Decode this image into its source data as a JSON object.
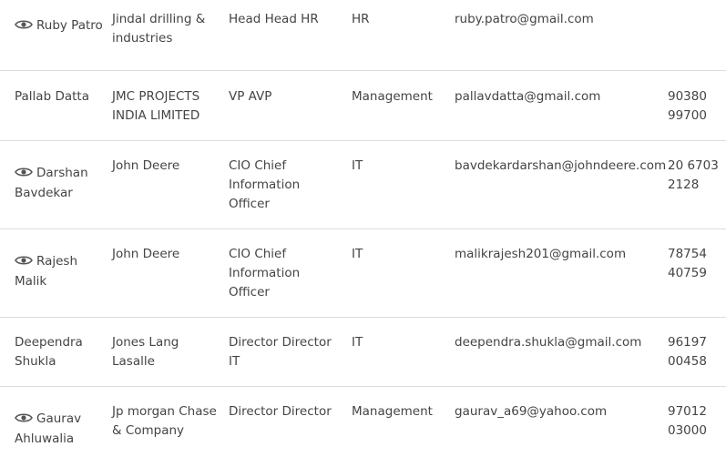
{
  "contacts": [
    {
      "name": "Ruby Patro",
      "has_view_icon": true,
      "company": "Jindal drilling & industries",
      "designation": "Head Head HR",
      "department": "HR",
      "email": "ruby.patro@gmail.com",
      "phone": ""
    },
    {
      "name": "Pallab Datta",
      "has_view_icon": false,
      "company": "JMC PROJECTS INDIA LIMITED",
      "designation": "VP AVP",
      "department": "Management",
      "email": "pallavdatta@gmail.com",
      "phone": "90380 99700"
    },
    {
      "name": "Darshan Bavdekar",
      "has_view_icon": true,
      "company": "John Deere",
      "designation": "CIO Chief Information Officer",
      "department": "IT",
      "email": "bavdekardarshan@johndeere.com",
      "phone": "20 6703 2128"
    },
    {
      "name": "Rajesh Malik",
      "has_view_icon": true,
      "company": "John Deere",
      "designation": "CIO Chief Information Officer",
      "department": "IT",
      "email": "malikrajesh201@gmail.com",
      "phone": "78754 40759"
    },
    {
      "name": "Deependra Shukla",
      "has_view_icon": false,
      "company": "Jones Lang Lasalle",
      "designation": "Director Director IT",
      "department": "IT",
      "email": "deependra.shukla@gmail.com",
      "phone": "96197 00458"
    },
    {
      "name": "Gaurav Ahluwalia",
      "has_view_icon": true,
      "company": "Jp morgan Chase & Company",
      "designation": "Director Director",
      "department": "Management",
      "email": "gaurav_a69@yahoo.com",
      "phone": "97012 03000"
    }
  ],
  "icons": {
    "view": "eye-icon"
  },
  "colors": {
    "text": "#444444",
    "divider": "#dcdcdc",
    "icon": "#555555"
  }
}
